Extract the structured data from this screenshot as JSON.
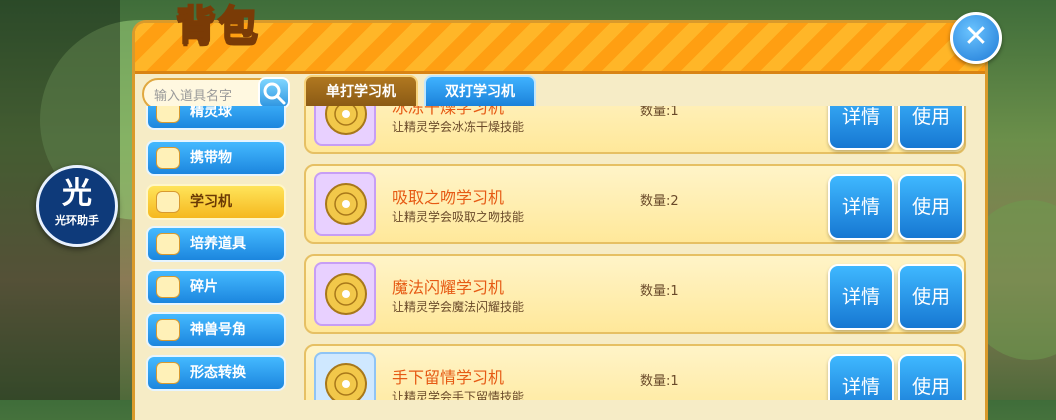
{
  "window": {
    "title": "背包",
    "close_label": "✕"
  },
  "search": {
    "placeholder": "输入道具名字",
    "icon": "search-icon"
  },
  "tabs": [
    {
      "label": "单打学习机",
      "active": true
    },
    {
      "label": "双打学习机",
      "active": false
    }
  ],
  "sidebar": {
    "items": [
      {
        "label": "精灵球",
        "icon": "pokeball-icon",
        "selected": false
      },
      {
        "label": "携带物",
        "icon": "bag-icon",
        "selected": false
      },
      {
        "label": "学习机",
        "icon": "disc-icon",
        "selected": true
      },
      {
        "label": "培养道具",
        "icon": "potion-icon",
        "selected": false
      },
      {
        "label": "碎片",
        "icon": "puzzle-icon",
        "selected": false
      },
      {
        "label": "神兽号角",
        "icon": "horn-icon",
        "selected": false
      },
      {
        "label": "形态转换",
        "icon": "transform-icon",
        "selected": false
      }
    ]
  },
  "items": [
    {
      "name": "冰冻干燥学习机",
      "desc": "让精灵学会冰冻干燥技能",
      "qty": "数量:1",
      "detail": "详情",
      "use": "使用"
    },
    {
      "name": "吸取之吻学习机",
      "desc": "让精灵学会吸取之吻技能",
      "qty": "数量:2",
      "detail": "详情",
      "use": "使用"
    },
    {
      "name": "魔法闪耀学习机",
      "desc": "让精灵学会魔法闪耀技能",
      "qty": "数量:1",
      "detail": "详情",
      "use": "使用"
    },
    {
      "name": "手下留情学习机",
      "desc": "让精灵学会手下留情技能",
      "qty": "数量:1",
      "detail": "详情",
      "use": "使用"
    }
  ],
  "helper": {
    "big": "光",
    "small": "光环助手"
  },
  "colors": {
    "accent": "#ff9f12",
    "button": "#1f84dc",
    "name_text": "#e65a14"
  }
}
